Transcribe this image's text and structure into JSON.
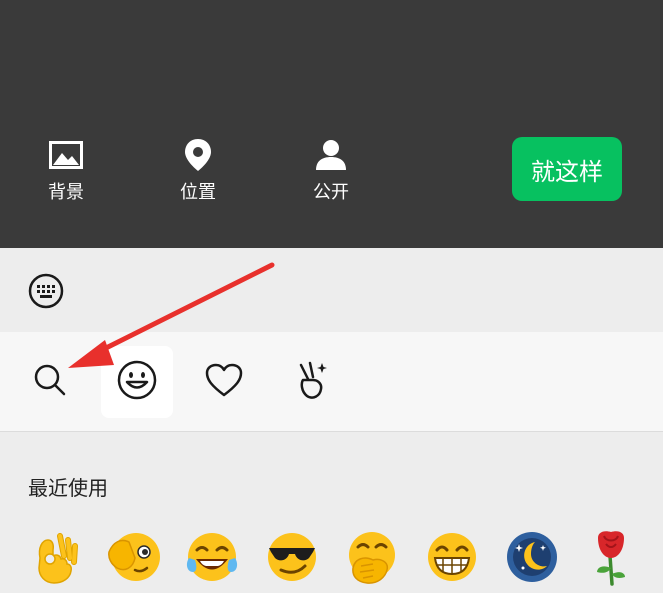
{
  "toolbar": {
    "background_label": "背景",
    "location_label": "位置",
    "visibility_label": "公开",
    "done_label": "就这样"
  },
  "emoji_panel": {
    "recent_title": "最近使用",
    "tabs": [
      "search-icon",
      "smiley-icon",
      "heart-icon",
      "victory-hand-icon"
    ],
    "recent_emojis": [
      "ok-hand",
      "cover-eye-face",
      "tears-of-joy",
      "sunglasses-face",
      "hand-over-mouth",
      "grinning-face",
      "moon-face",
      "rose"
    ]
  },
  "colors": {
    "top_bg": "#3a3a3a",
    "accent": "#07c160",
    "annotation_arrow": "#e8302c"
  }
}
